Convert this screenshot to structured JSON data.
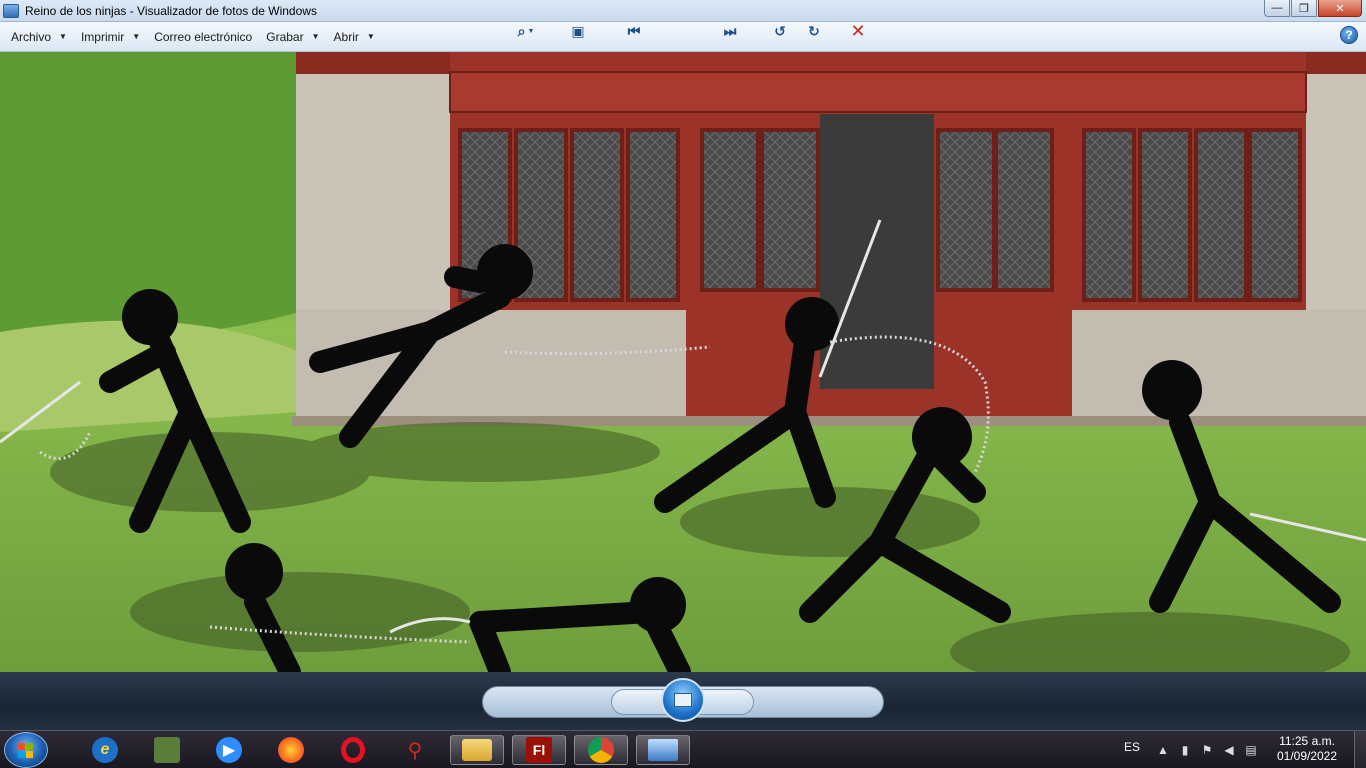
{
  "window": {
    "title": "Reino de los ninjas - Visualizador de fotos de Windows",
    "controls": {
      "minimize": "—",
      "maximize": "❐",
      "close": "✕"
    }
  },
  "menu": {
    "items": [
      "Archivo",
      "Imprimir",
      "Correo electrónico",
      "Grabar",
      "Abrir"
    ],
    "help_icon": "?"
  },
  "photo": {
    "description_icon": "image-viewer-photo"
  },
  "controls": {
    "zoom_icon": "⌕",
    "fit_icon": "▣",
    "prev_icon": "⏮",
    "next_icon": "⏭",
    "rotate_ccw_icon": "↺",
    "rotate_cw_icon": "↻",
    "delete_icon": "✕"
  },
  "taskbar": {
    "items": [
      "start",
      "internet-explorer",
      "minecraft",
      "zoom",
      "firefox",
      "opera",
      "stick-figure-app",
      "file-explorer",
      "flash",
      "chrome",
      "photo-viewer"
    ],
    "flash_label": "Fl",
    "lang": "ES",
    "time": "11:25 a.m.",
    "date": "01/09/2022"
  },
  "colors": {
    "titlebar": "#c9daee",
    "menubar": "#dce7f4",
    "taskbar": "#191720",
    "accent": "#1d5fae",
    "close": "#c7442b"
  }
}
